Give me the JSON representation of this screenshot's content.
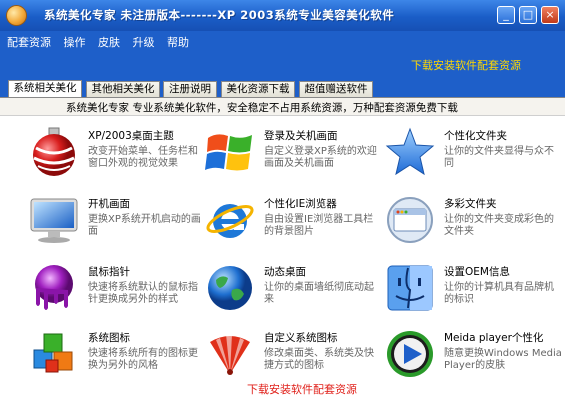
{
  "window": {
    "title": "系统美化专家    未注册版本-------XP   2003系统专业美容美化软件",
    "controls": {
      "minimize": "_",
      "restore": "□",
      "close": "×"
    }
  },
  "menu": [
    "配套资源",
    "操作",
    "皮肤",
    "升级",
    "帮助"
  ],
  "banner": {
    "link": "下载安装软件配套资源"
  },
  "tabs": [
    "系统相关美化",
    "其他相关美化",
    "注册说明",
    "美化资源下载",
    "超值赠送软件"
  ],
  "active_tab": "系统相关美化",
  "info": "系统美化专家   专业系统美化软件，安全稳定不占用系统资源，万种配套资源免费下载",
  "items": [
    {
      "name": "XP/2003桌面主题",
      "desc": "改变开始菜单、任务栏和窗口外观的视觉效果",
      "icon": "christmas-ornament-icon"
    },
    {
      "name": "登录及关机画面",
      "desc": "自定义登录XP系统的欢迎画面及关机画面",
      "icon": "windows-logo-icon"
    },
    {
      "name": "个性化文件夹",
      "desc": "让你的文件夹显得与众不同",
      "icon": "blue-star-icon"
    },
    {
      "name": "开机画面",
      "desc": "更换XP系统开机启动的画面",
      "icon": "monitor-icon"
    },
    {
      "name": "个性化IE浏览器",
      "desc": "自由设置IE浏览器工具栏的背景图片",
      "icon": "internet-explorer-icon"
    },
    {
      "name": "多彩文件夹",
      "desc": "让你的文件夹变成彩色的文件夹",
      "icon": "browser-window-icon"
    },
    {
      "name": "鼠标指针",
      "desc": "快速将系统默认的鼠标指针更换成另外的样式",
      "icon": "purple-paint-icon"
    },
    {
      "name": "动态桌面",
      "desc": "让你的桌面墙纸彻底动起来",
      "icon": "globe-icon"
    },
    {
      "name": "设置OEM信息",
      "desc": "让你的计算机具有品牌机的标识",
      "icon": "finder-face-icon"
    },
    {
      "name": "系统图标",
      "desc": "快速将系统所有的图标更换为另外的风格",
      "icon": "colored-cubes-icon"
    },
    {
      "name": "自定义系统图标",
      "desc": "修改桌面类、系统类及快捷方式的图标",
      "icon": "red-fan-icon"
    },
    {
      "name": "Meida player个性化",
      "desc": "随意更换Windows Media Player的皮肤",
      "icon": "media-player-icon"
    }
  ],
  "footer_link": "下载安装软件配套资源"
}
